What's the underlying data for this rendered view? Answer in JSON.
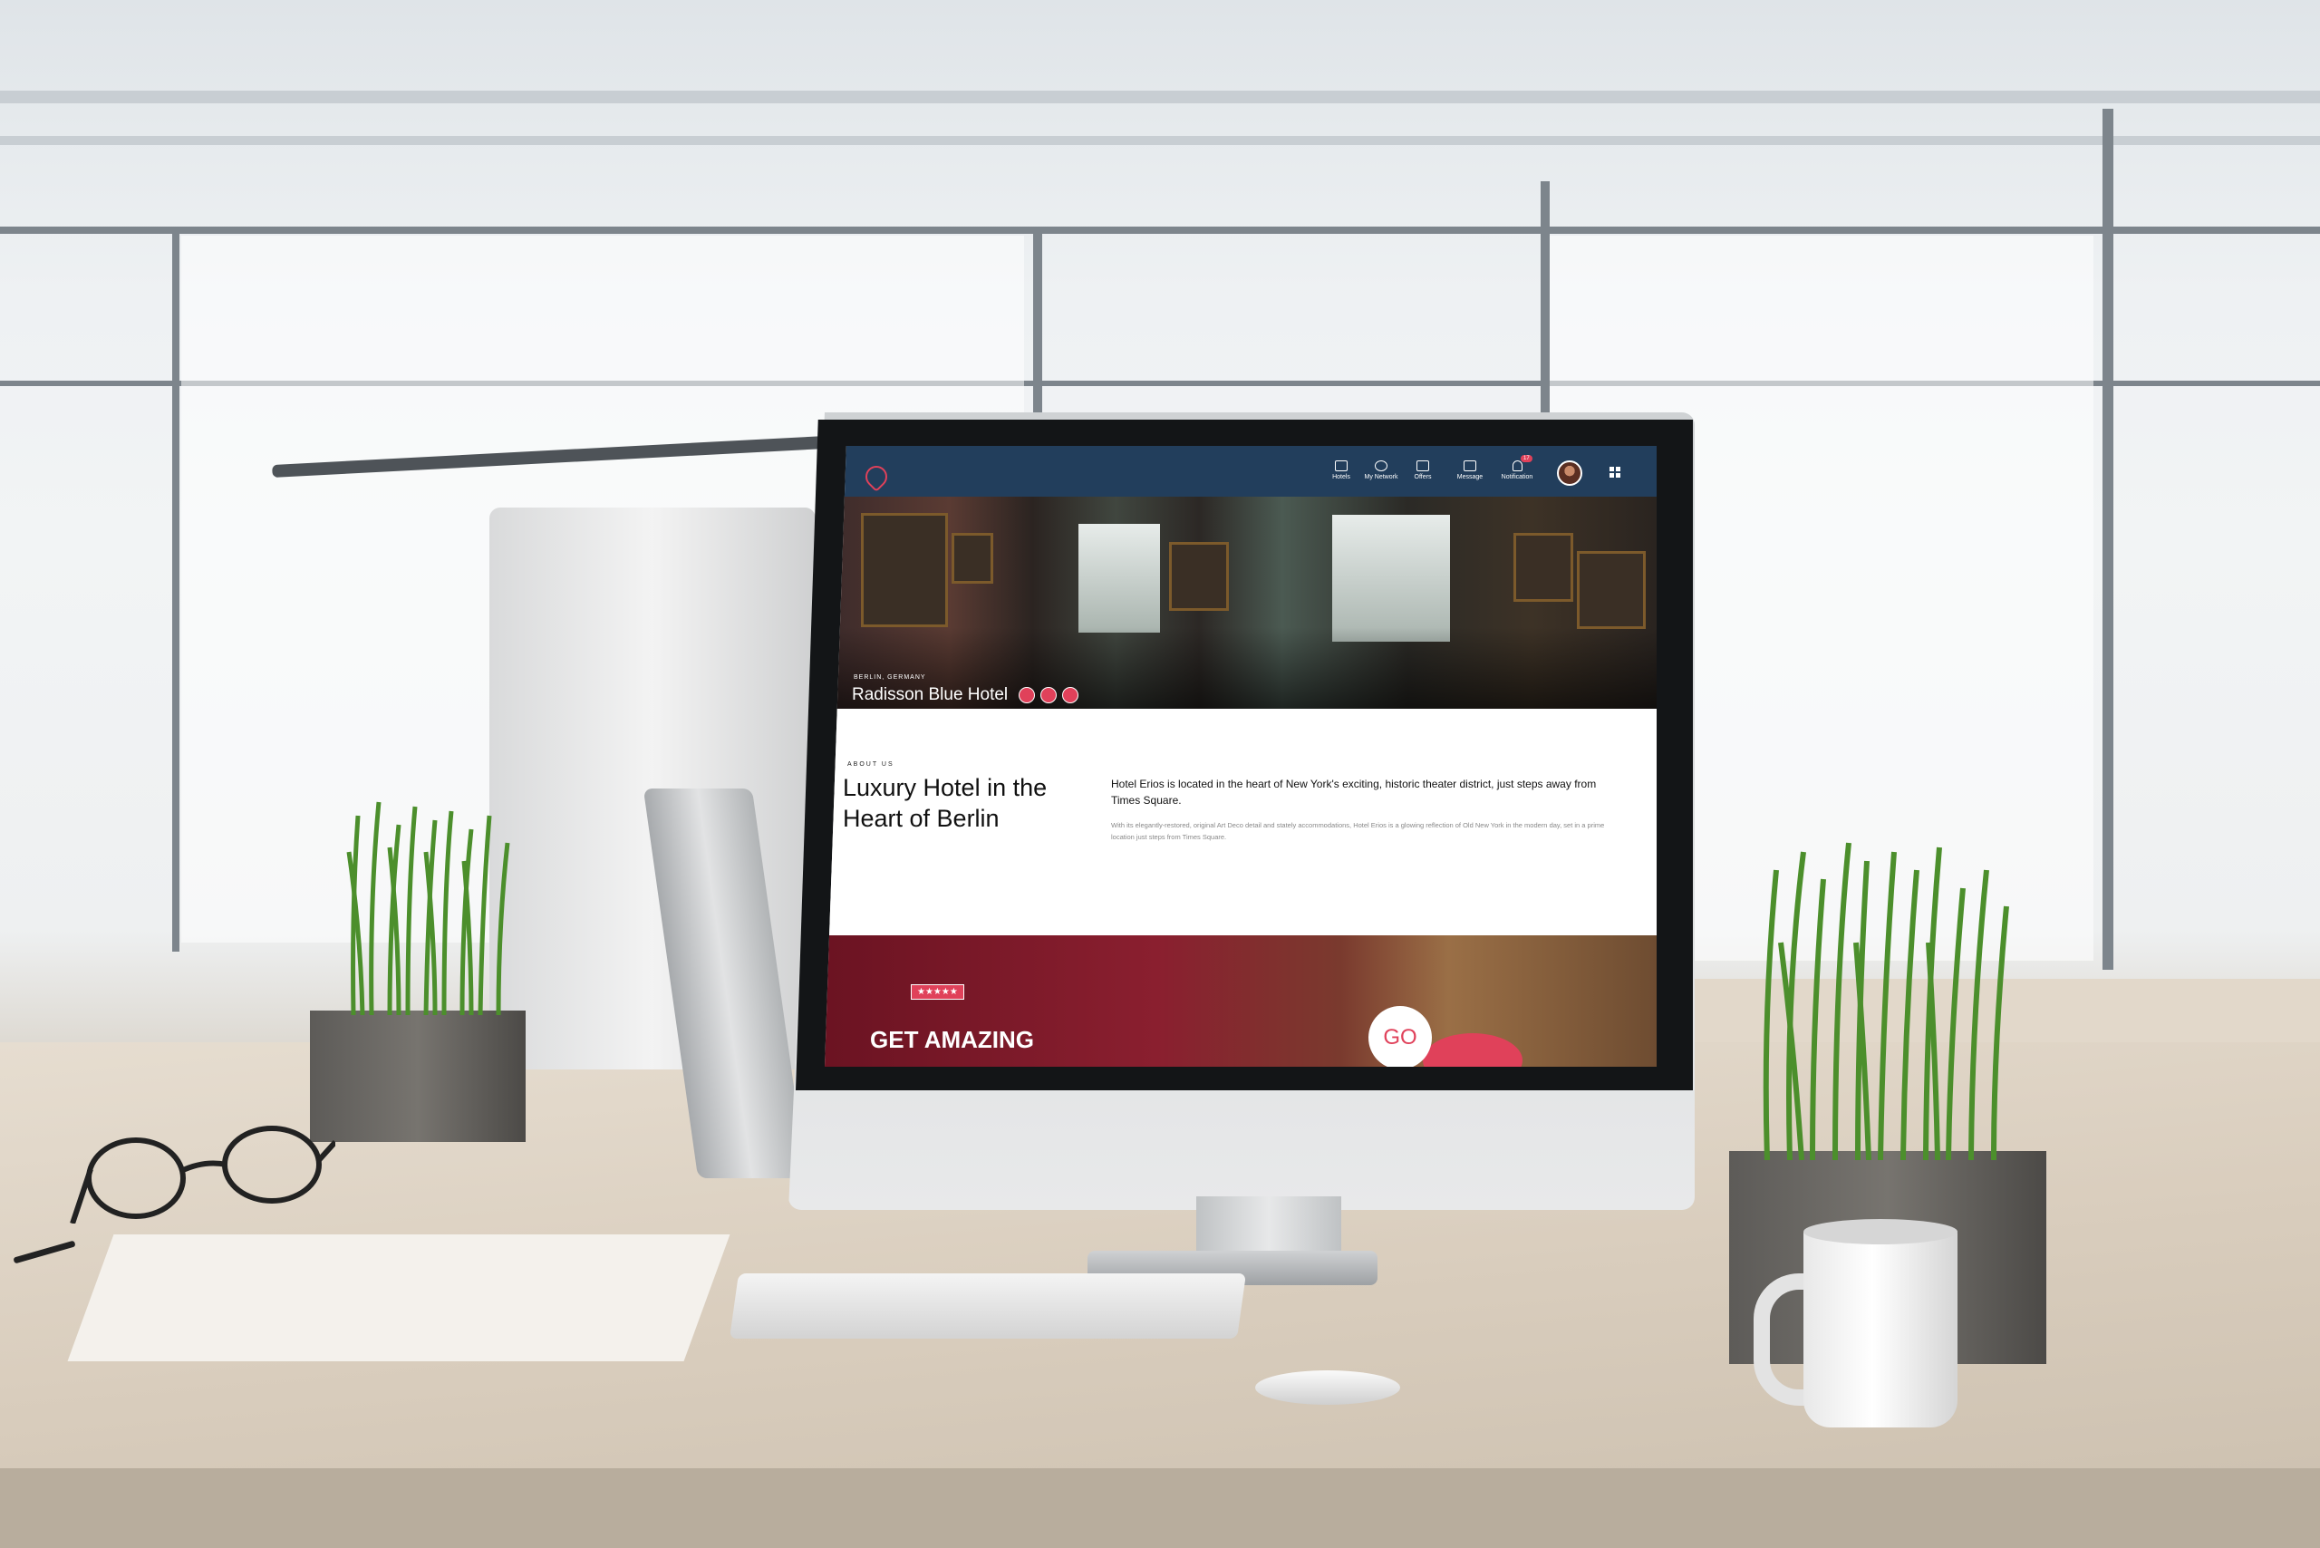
{
  "navbar": {
    "items": [
      {
        "label": "Hotels",
        "icon": "bed-icon"
      },
      {
        "label": "My Network",
        "icon": "people-icon"
      },
      {
        "label": "Offers",
        "icon": "tag-icon"
      },
      {
        "label": "Message",
        "icon": "message-icon"
      },
      {
        "label": "Notification",
        "icon": "bell-icon",
        "badge": "17"
      }
    ],
    "accent": "#e0415a",
    "background": "#223e5c"
  },
  "hero": {
    "location": "BERLIN, GERMANY",
    "title": "Radisson Blue Hotel"
  },
  "about": {
    "kicker": "ABOUT US",
    "title": "Luxury Hotel in the Heart of Berlin",
    "lead": "Hotel Erios is located in the heart of New York's exciting, historic theater district, just steps away from Times Square.",
    "body": "With its elegantly-restored, original Art Deco detail and stately accommodations, Hotel Erios is a glowing reflection of Old New York in the modern day, set in a prime location just steps from Times Square."
  },
  "promo": {
    "stars": "★★★★★",
    "headline": "GET AMAZING",
    "go_label": "GO"
  }
}
